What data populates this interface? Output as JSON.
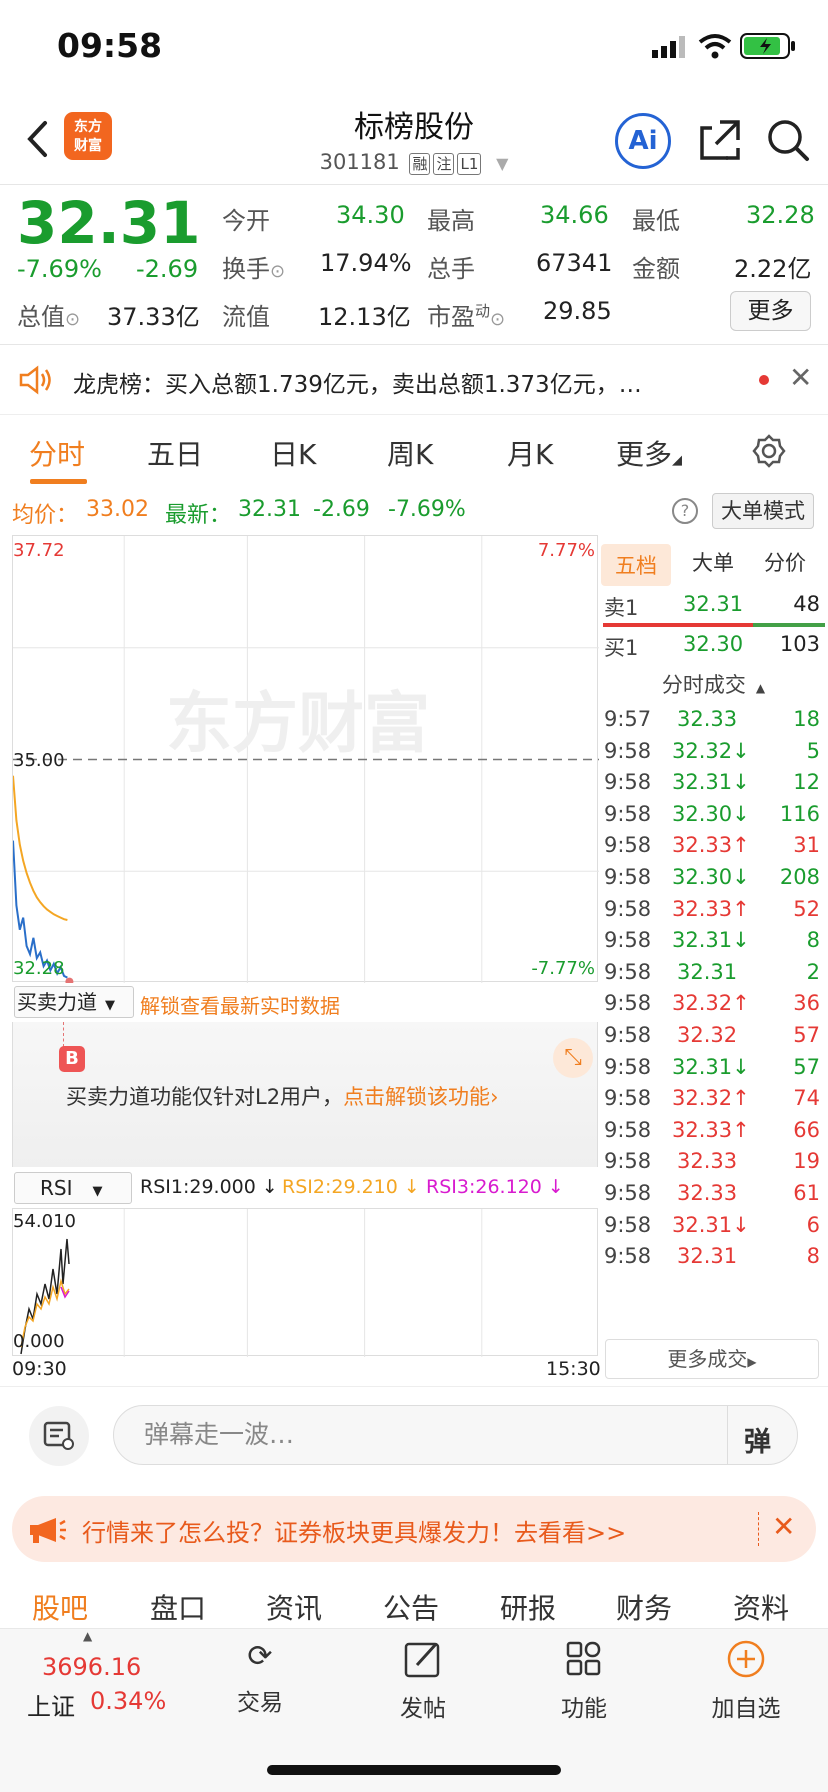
{
  "status": {
    "time": "09:58"
  },
  "header": {
    "logo_line1": "东方",
    "logo_line2": "财富",
    "stock_name": "标榜股份",
    "stock_code": "301181",
    "tags": [
      "融",
      "注",
      "L1"
    ],
    "ai_label": "Ai"
  },
  "quote": {
    "price": "32.31",
    "change_pct": "-7.69%",
    "change": "-2.69",
    "open_label": "今开",
    "open": "34.30",
    "high_label": "最高",
    "high": "34.66",
    "low_label": "最低",
    "low": "32.28",
    "turnover_label": "换手",
    "turnover": "17.94%",
    "volume_label": "总手",
    "volume": "67341",
    "amount_label": "金额",
    "amount": "2.22亿",
    "mktcap_label": "总值",
    "mktcap": "37.33亿",
    "float_label": "流值",
    "float": "12.13亿",
    "pe_label": "市盈",
    "pe_sup": "动",
    "pe": "29.85",
    "more_label": "更多"
  },
  "ticker": {
    "text": "龙虎榜：买入总额1.739亿元，卖出总额1.373亿元，…"
  },
  "tabs": [
    "分时",
    "五日",
    "日K",
    "周K",
    "月K",
    "更多"
  ],
  "chart_info": {
    "avg_label": "均价：",
    "avg": "33.02",
    "latest_label": "最新：",
    "latest": "32.31",
    "latest_change": "-2.69",
    "latest_pct": "-7.69%",
    "mode_label": "大单模式"
  },
  "chart_data": {
    "type": "line",
    "y_max_label": "37.72",
    "y_mid_label": "35.00",
    "y_min_label": "32.28",
    "pct_max_label": "7.77%",
    "pct_min_label": "-7.77%",
    "watermark": "东方财富",
    "ylim": [
      32.28,
      37.72
    ],
    "prev_close": 35.0,
    "series": [
      {
        "color": "#f4a623",
        "values": [
          34.8,
          34.25,
          33.95,
          33.75,
          33.6,
          33.48,
          33.38,
          33.3,
          33.24,
          33.19,
          33.15,
          33.12,
          33.09,
          33.07,
          33.05,
          33.03,
          33.02
        ]
      },
      {
        "color": "#2a6fc9",
        "values": [
          34.0,
          33.2,
          32.9,
          33.05,
          32.7,
          32.6,
          32.8,
          32.55,
          32.62,
          32.45,
          32.52,
          32.4,
          32.48,
          32.36,
          32.44,
          32.33,
          32.31
        ]
      }
    ],
    "time_start": "09:30",
    "time_end": "15:30"
  },
  "bs_bar": {
    "selector": "买卖力道",
    "unlock_text": "解锁查看最新实时数据",
    "marker": "B"
  },
  "lock_panel": {
    "text": "买卖力道功能仅针对L2用户，",
    "link": "点击解锁该功能"
  },
  "rsi": {
    "selector": "RSI",
    "rsi1": "RSI1:29.000",
    "rsi2": "RSI2:29.210",
    "rsi3": "RSI3:26.120",
    "max_label": "54.010",
    "min_label": "0.000"
  },
  "book": {
    "tabs": [
      "五档",
      "大单",
      "分价"
    ],
    "sell1_label": "卖1",
    "sell1_price": "32.31",
    "sell1_vol": "48",
    "buy1_label": "买1",
    "buy1_price": "32.30",
    "buy1_vol": "103",
    "trades_title": "分时成交",
    "more_trades": "更多成交",
    "trades": [
      {
        "t": "9:57",
        "p": "32.33",
        "a": "",
        "v": "18",
        "c": "g"
      },
      {
        "t": "9:58",
        "p": "32.32",
        "a": "↓",
        "v": "5",
        "c": "g"
      },
      {
        "t": "9:58",
        "p": "32.31",
        "a": "↓",
        "v": "12",
        "c": "g"
      },
      {
        "t": "9:58",
        "p": "32.30",
        "a": "↓",
        "v": "116",
        "c": "g"
      },
      {
        "t": "9:58",
        "p": "32.33",
        "a": "↑",
        "v": "31",
        "c": "r"
      },
      {
        "t": "9:58",
        "p": "32.30",
        "a": "↓",
        "v": "208",
        "c": "g"
      },
      {
        "t": "9:58",
        "p": "32.33",
        "a": "↑",
        "v": "52",
        "c": "r"
      },
      {
        "t": "9:58",
        "p": "32.31",
        "a": "↓",
        "v": "8",
        "c": "g"
      },
      {
        "t": "9:58",
        "p": "32.31",
        "a": "",
        "v": "2",
        "c": "g"
      },
      {
        "t": "9:58",
        "p": "32.32",
        "a": "↑",
        "v": "36",
        "c": "r"
      },
      {
        "t": "9:58",
        "p": "32.32",
        "a": "",
        "v": "57",
        "c": "r"
      },
      {
        "t": "9:58",
        "p": "32.31",
        "a": "↓",
        "v": "57",
        "c": "g"
      },
      {
        "t": "9:58",
        "p": "32.32",
        "a": "↑",
        "v": "74",
        "c": "r"
      },
      {
        "t": "9:58",
        "p": "32.33",
        "a": "↑",
        "v": "66",
        "c": "r"
      },
      {
        "t": "9:58",
        "p": "32.33",
        "a": "",
        "v": "19",
        "c": "r"
      },
      {
        "t": "9:58",
        "p": "32.33",
        "a": "",
        "v": "61",
        "c": "r"
      },
      {
        "t": "9:58",
        "p": "32.31",
        "a": "↓",
        "v": "6",
        "c": "r"
      },
      {
        "t": "9:58",
        "p": "32.31",
        "a": "",
        "v": "8",
        "c": "r"
      }
    ]
  },
  "comment": {
    "placeholder": "弹幕走一波…",
    "send_label": "弹"
  },
  "promo": {
    "text": "行情来了怎么投？证券板块更具爆发力！去看看>>"
  },
  "subtabs": [
    "股吧",
    "盘口",
    "资讯",
    "公告",
    "研报",
    "财务",
    "资料"
  ],
  "dock": {
    "index_value": "3696.16",
    "index_name": "上证",
    "index_pct": "0.34%",
    "items": [
      "交易",
      "发帖",
      "功能",
      "加自选"
    ]
  }
}
